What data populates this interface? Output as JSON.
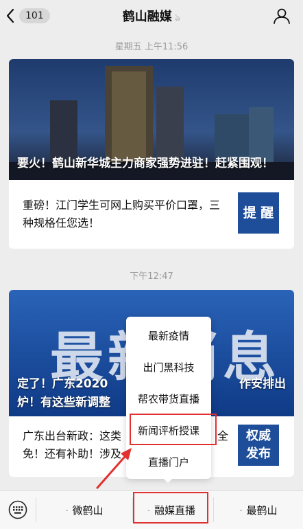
{
  "header": {
    "unread_count": "101",
    "title": "鹤山融媒"
  },
  "messages": [
    {
      "timestamp": "星期五 上午11:56",
      "hero_caption": "要火！鹤山新华城主力商家强势进驻！赶紧围观！",
      "sub_text": "重磅！江门学生可网上购买平价口罩，三种规格任您选！",
      "thumb_label": "提 醒"
    },
    {
      "timestamp": "下午12:47",
      "hero_big_text": "最新消息",
      "hero_caption_line1": "定了！广东2020",
      "hero_caption_line1_tail": "作安排出",
      "hero_caption_line2": "炉！有这些新调整",
      "sub_text_line1": "广东出台新政：这类",
      "sub_text_line1_tail": "全",
      "sub_text_line2": "免！还有补助！涉及",
      "thumb_label_line1": "权威",
      "thumb_label_line2": "发布"
    }
  ],
  "popup_menu": {
    "items": [
      "最新疫情",
      "出门黑科技",
      "帮农带货直播",
      "新闻评析授课",
      "直播门户"
    ]
  },
  "bottom_bar": {
    "tabs": [
      "微鹤山",
      "融媒直播",
      "最鹤山"
    ]
  },
  "colors": {
    "highlight": "#e0302f",
    "thumb_blue": "#1e4e9a"
  }
}
